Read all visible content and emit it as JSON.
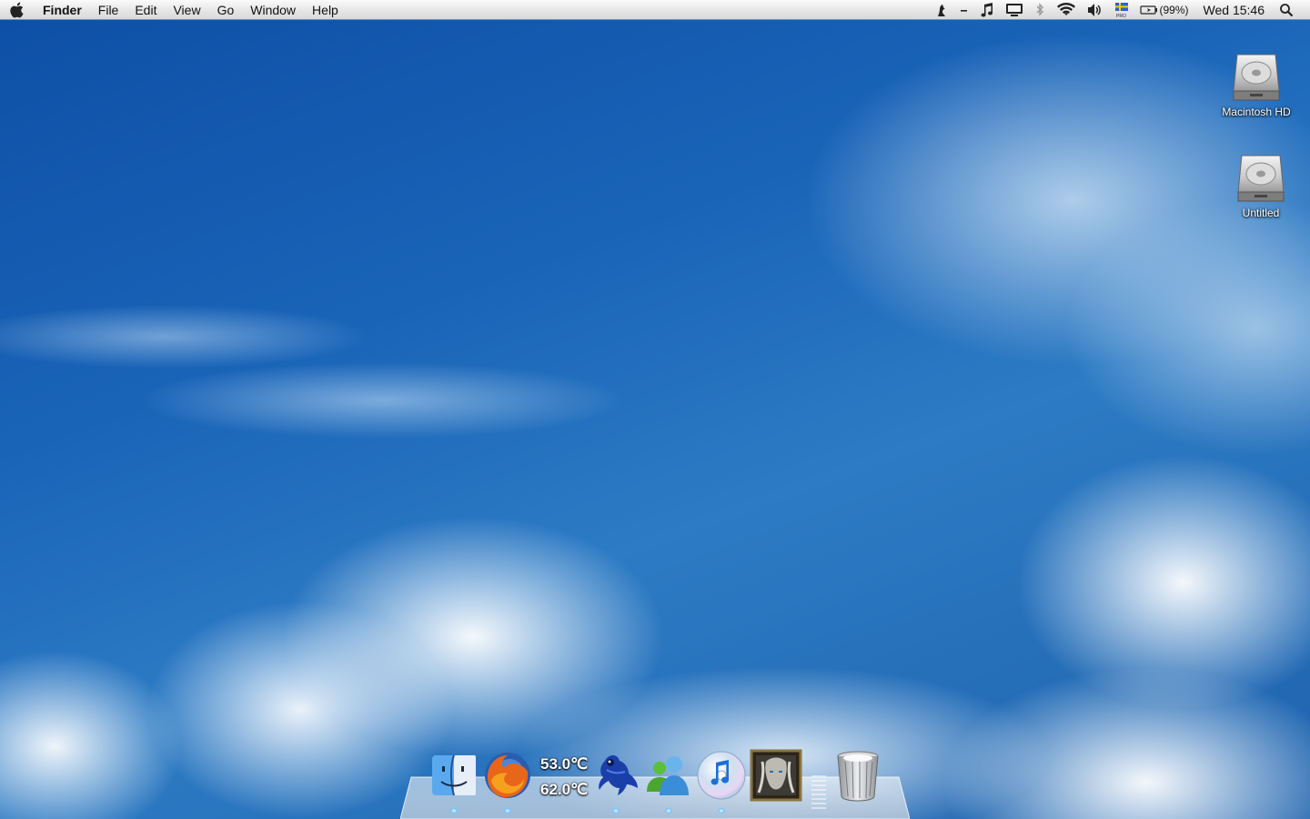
{
  "menubar": {
    "apple_icon": "apple-icon",
    "app_name": "Finder",
    "menus": [
      "File",
      "Edit",
      "View",
      "Go",
      "Window",
      "Help"
    ],
    "status_icons": [
      "script-icon",
      "dash-icon",
      "music-note-icon",
      "display-icon",
      "bluetooth-icon",
      "wifi-icon",
      "volume-icon",
      "flag-icon",
      "battery-icon"
    ],
    "battery_percent": "(99%)",
    "clock": "Wed 15:46",
    "spotlight_icon": "magnifier-icon"
  },
  "desktop_icons": [
    {
      "label": "Macintosh HD",
      "icon": "hard-drive-icon"
    },
    {
      "label": "Untitled",
      "icon": "hard-drive-icon"
    }
  ],
  "dock": {
    "items": [
      {
        "name": "Finder",
        "icon": "finder-icon",
        "running": true
      },
      {
        "name": "Firefox",
        "icon": "firefox-icon",
        "running": true
      },
      {
        "name": "Temperature Monitor",
        "icon": "temperature-widget",
        "running": false
      },
      {
        "name": "Adium",
        "icon": "frog-icon",
        "running": true
      },
      {
        "name": "Messenger",
        "icon": "messenger-icon",
        "running": true
      },
      {
        "name": "iTunes",
        "icon": "itunes-icon",
        "running": true
      },
      {
        "name": "Warcraft",
        "icon": "game-portrait-icon",
        "running": false
      },
      {
        "name": "Trash",
        "icon": "trash-icon",
        "running": false
      }
    ],
    "temps": [
      "53.0℃",
      "62.0℃"
    ]
  }
}
